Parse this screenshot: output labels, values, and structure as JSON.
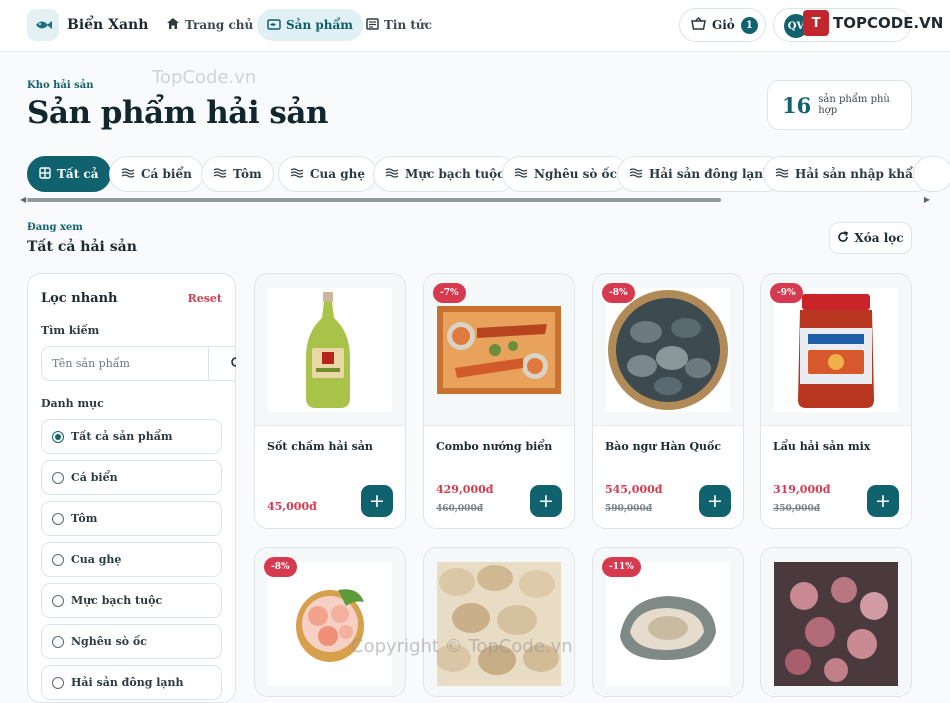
{
  "header": {
    "brand": "Biển Xanh",
    "nav": [
      {
        "label": "Trang chủ",
        "icon": "home-icon",
        "active": false
      },
      {
        "label": "Sản phẩm",
        "icon": "fish-box-icon",
        "active": true
      },
      {
        "label": "Tin tức",
        "icon": "newspaper-icon",
        "active": false
      }
    ],
    "cart_label": "Giỏ",
    "cart_count": "1",
    "user_initials": "QV",
    "watermark_logo": "TOPCODE.VN",
    "watermark_logo_mark": "T"
  },
  "page": {
    "eyebrow": "Kho hải sản",
    "title": "Sản phẩm hải sản",
    "count": "16",
    "count_label": "sản phẩm phù hợp"
  },
  "chips": [
    "Tất cả",
    "Cá biển",
    "Tôm",
    "Cua ghẹ",
    "Mực bạch tuộc",
    "Nghêu sò ốc",
    "Hải sản đông lạnh",
    "Hải sản nhập khẩu"
  ],
  "viewing": {
    "label": "Đang xem",
    "value": "Tất cả hải sản"
  },
  "clear_label": "Xóa lọc",
  "sidebar": {
    "title": "Lọc nhanh",
    "reset": "Reset",
    "search_label": "Tìm kiếm",
    "search_placeholder": "Tên sản phẩm",
    "category_label": "Danh mục",
    "categories": [
      "Tất cả sản phẩm",
      "Cá biển",
      "Tôm",
      "Cua ghẹ",
      "Mực bạch tuộc",
      "Nghêu sò ốc",
      "Hải sản đông lạnh"
    ],
    "selected": 0
  },
  "products": [
    {
      "name": "Sốt chấm hải sản",
      "price": "45,000đ",
      "old_price": "",
      "discount": "",
      "image": "sauce-bottle"
    },
    {
      "name": "Combo nướng biển",
      "price": "429,000đ",
      "old_price": "460,000đ",
      "discount": "-7%",
      "image": "grilled-platter"
    },
    {
      "name": "Bào ngư Hàn Quốc",
      "price": "545,000đ",
      "old_price": "590,000đ",
      "discount": "-8%",
      "image": "abalone-basket"
    },
    {
      "name": "Lẩu hải sản mix",
      "price": "319,000đ",
      "old_price": "350,000đ",
      "discount": "-9%",
      "image": "hotpot-jar"
    },
    {
      "name": "",
      "price": "",
      "old_price": "",
      "discount": "-8%",
      "image": "shrimp-bowl"
    },
    {
      "name": "",
      "price": "",
      "old_price": "",
      "discount": "",
      "image": "clams"
    },
    {
      "name": "",
      "price": "",
      "old_price": "",
      "discount": "-11%",
      "image": "oyster"
    },
    {
      "name": "",
      "price": "",
      "old_price": "",
      "discount": "",
      "image": "baby-octopus"
    }
  ],
  "watermark": "Copyright © TopCode.vn",
  "watermark2": "TopCode.vn",
  "colors": {
    "accent": "#11626f",
    "sale": "#d63a4f",
    "bg": "#f8fafb"
  }
}
